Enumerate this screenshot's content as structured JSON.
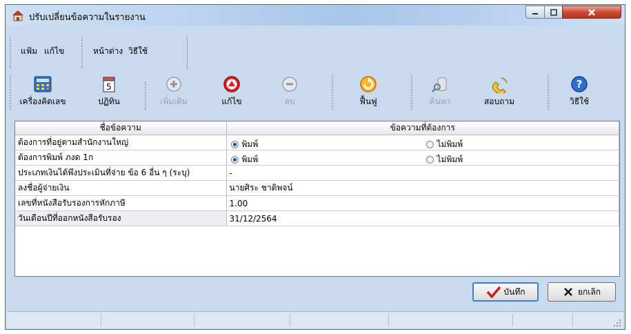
{
  "window": {
    "title": "ปรับเปลี่ยนข้อความในรายงาน"
  },
  "menu": [
    "แฟ้ม",
    "แก้ไข",
    "หน้าต่าง",
    "วิธีใช้"
  ],
  "toolbar": [
    {
      "label": "เครื่องคิดเลข",
      "icon": "calculator-icon",
      "enabled": true
    },
    {
      "label": "ปฏิทิน",
      "icon": "calendar-icon",
      "enabled": true
    },
    {
      "label": "เพิ่มเติม",
      "icon": "add-icon",
      "enabled": false
    },
    {
      "label": "แก้ไข",
      "icon": "edit-icon",
      "enabled": true
    },
    {
      "label": "ลบ",
      "icon": "delete-icon",
      "enabled": false
    },
    {
      "label": "ฟื้นฟู",
      "icon": "refresh-icon",
      "enabled": true
    },
    {
      "label": "ค้นหา",
      "icon": "search-icon",
      "enabled": false
    },
    {
      "label": "สอบถาม",
      "icon": "phone-icon",
      "enabled": true
    },
    {
      "label": "วิธีใช้",
      "icon": "help-icon",
      "enabled": true
    }
  ],
  "calendar_icon_number": "5",
  "table": {
    "headers": [
      "ชื่อข้อความ",
      "ข้อความที่ต้องการ"
    ],
    "rows": [
      {
        "name": "ต้องการที่อยู่ตามสำนักงานใหญ่",
        "opt1": "พิมพ์",
        "opt2": "ไม่พิมพ์",
        "selected": "opt1"
      },
      {
        "name": "ต้องการพิมพ์ ภงด 1ก",
        "opt1": "พิมพ์",
        "opt2": "ไม่พิมพ์",
        "selected": "opt1"
      },
      {
        "name": "ประเภทเงินได้พึงประเมินที่จ่าย ข้อ 6 อื่น ๆ (ระบุ)",
        "value": "-"
      },
      {
        "name": "ลงชื่อผู้จ่ายเงิน",
        "value": "นายศิระ ชาติพจน์"
      },
      {
        "name": "เลขที่หนังสือรับรองการหักภาษี",
        "value": "1.00"
      },
      {
        "name": "วันเดือนปีที่ออกหนังสือรับรอง",
        "value": "31/12/2564"
      }
    ]
  },
  "buttons": {
    "save": "บันทึก",
    "cancel": "ยกเลิก"
  },
  "colors": {
    "window_bg": "#c9d9ee",
    "close": "#c9482f",
    "grid_border": "#b6bcc6"
  }
}
